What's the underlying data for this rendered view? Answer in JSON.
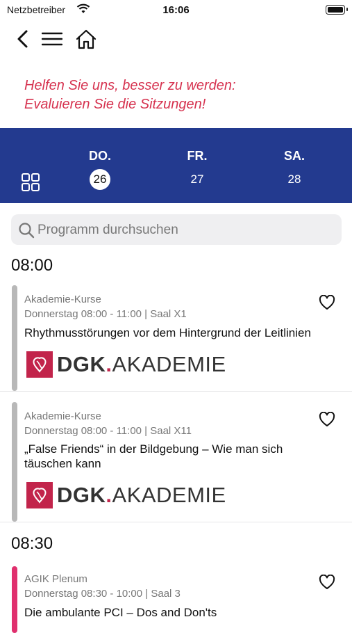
{
  "status": {
    "carrier": "Netzbetreiber",
    "time": "16:06"
  },
  "banner": {
    "line1": "Helfen Sie uns, besser zu werden:",
    "line2": "Evaluieren Sie die Sitzungen!"
  },
  "days": [
    {
      "abbr": "DO.",
      "num": "26",
      "selected": true
    },
    {
      "abbr": "FR.",
      "num": "27",
      "selected": false
    },
    {
      "abbr": "SA.",
      "num": "28",
      "selected": false
    }
  ],
  "search": {
    "placeholder": "Programm durchsuchen"
  },
  "sections": [
    {
      "time": "08:00"
    },
    {
      "time": "08:30"
    }
  ],
  "sessions": [
    {
      "category": "Akademie-Kurse",
      "meta": "Donnerstag 08:00 - 11:00 | Saal X1",
      "title": "Rhythmusstörungen vor dem Hintergrund der Leitlinien",
      "bar_color": "#b8b8b8"
    },
    {
      "category": "Akademie-Kurse",
      "meta": "Donnerstag 08:00 - 11:00 | Saal X11",
      "title": "„False Friends“ in der Bildgebung – Wie man sich täuschen kann",
      "bar_color": "#b8b8b8"
    },
    {
      "category": "AGIK Plenum",
      "meta": "Donnerstag 08:30 - 10:00 | Saal 3",
      "title": "Die ambulante PCI – Dos and Don'ts",
      "bar_color": "#e0306e"
    }
  ],
  "logo": {
    "bold": "DGK",
    "dot": ".",
    "rest": "AKADEMIE"
  },
  "colors": {
    "header_blue": "#233a8f",
    "banner_red": "#d6324f",
    "logo_red": "#c2244b"
  }
}
